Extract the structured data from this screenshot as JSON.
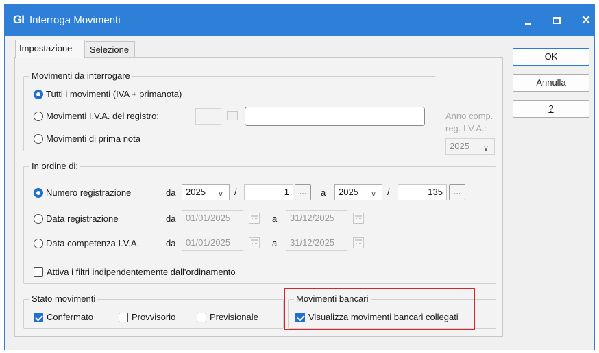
{
  "window": {
    "app_icon_text": "GI",
    "title": "Interroga Movimenti",
    "controls": {
      "minimize": "minimize-icon",
      "maximize": "maximize-icon",
      "close": "✕"
    }
  },
  "tabs": [
    {
      "label": "Impostazione",
      "active": true
    },
    {
      "label": "Selezione",
      "active": false
    }
  ],
  "buttons": {
    "ok": "OK",
    "annulla": "Annulla",
    "help": "?"
  },
  "movimenti_group": {
    "label": "Movimenti da interrogare",
    "options": [
      {
        "label": "Tutti i movimenti (IVA + primanota)",
        "selected": true
      },
      {
        "label": "Movimenti I.V.A. del registro:",
        "selected": false
      },
      {
        "label": "Movimenti di prima nota",
        "selected": false
      }
    ],
    "registro_value": "",
    "registro_desc": "",
    "anno_comp_label_1": "Anno comp.",
    "anno_comp_label_2": "reg. I.V.A.:",
    "anno_comp_value": "2025"
  },
  "ordine_group": {
    "label": "In ordine di:",
    "da": "da",
    "a": "a",
    "slash": "/",
    "dots": "...",
    "numero": {
      "label": "Numero registrazione",
      "selected": true,
      "anno_da": "2025",
      "num_da": "1",
      "anno_a": "2025",
      "num_a": "135"
    },
    "data_reg": {
      "label": "Data registrazione",
      "selected": false,
      "da": "01/01/2025",
      "a": "31/12/2025"
    },
    "data_comp": {
      "label": "Data competenza I.V.A.",
      "selected": false,
      "da": "01/01/2025",
      "a": "31/12/2025"
    },
    "filtri_check": {
      "label": "Attiva i filtri indipendentemente dall'ordinamento",
      "checked": false
    }
  },
  "stato_group": {
    "label": "Stato movimenti",
    "items": [
      {
        "label": "Confermato",
        "checked": true
      },
      {
        "label": "Provvisorio",
        "checked": false
      },
      {
        "label": "Previsionale",
        "checked": false
      }
    ]
  },
  "bancari_group": {
    "label": "Movimenti bancari",
    "check": {
      "label": "Visualizza movimenti bancari collegati",
      "checked": true
    }
  },
  "colors": {
    "accent": "#2d7fd8",
    "highlight": "#d9262c"
  }
}
